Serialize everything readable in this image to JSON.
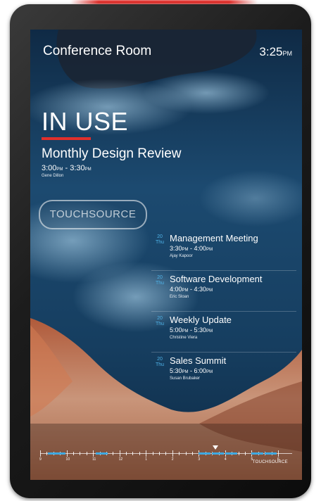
{
  "room": {
    "name": "Conference Room"
  },
  "clock": {
    "time": "3:25",
    "suffix": "PM"
  },
  "status": {
    "label": "IN USE",
    "color": "#e0302c"
  },
  "current_meeting": {
    "title": "Monthly Design Review",
    "start": "3:00",
    "start_suffix": "PM",
    "separator": " - ",
    "end": "3:30",
    "end_suffix": "PM",
    "organizer": "Gene Dillon"
  },
  "brand": {
    "logo_text": "TOUCHSOURCE",
    "footer_logo_text": "TOUCHSOURCE"
  },
  "upcoming": [
    {
      "day": "20",
      "weekday": "Thu",
      "title": "Management Meeting",
      "start": "3:30",
      "start_suffix": "PM",
      "end": "4:00",
      "end_suffix": "PM",
      "organizer": "Ajay Kapoor"
    },
    {
      "day": "20",
      "weekday": "Thu",
      "title": "Software Development",
      "start": "4:00",
      "start_suffix": "PM",
      "end": "4:30",
      "end_suffix": "PM",
      "organizer": "Eric Sloan"
    },
    {
      "day": "20",
      "weekday": "Thu",
      "title": "Weekly Update",
      "start": "5:00",
      "start_suffix": "PM",
      "end": "5:30",
      "end_suffix": "PM",
      "organizer": "Christine Viera"
    },
    {
      "day": "20",
      "weekday": "Thu",
      "title": "Sales Summit",
      "start": "5:30",
      "start_suffix": "PM",
      "end": "6:00",
      "end_suffix": "PM",
      "organizer": "Susan Brubaker"
    }
  ],
  "timeline": {
    "hour_labels": [
      "9",
      "10",
      "11",
      "12",
      "1",
      "2",
      "3",
      "4",
      "5",
      "6"
    ],
    "current_hour_fraction": 0.695
  },
  "colors": {
    "accent": "#4fb3e8",
    "status": "#e0302c"
  }
}
